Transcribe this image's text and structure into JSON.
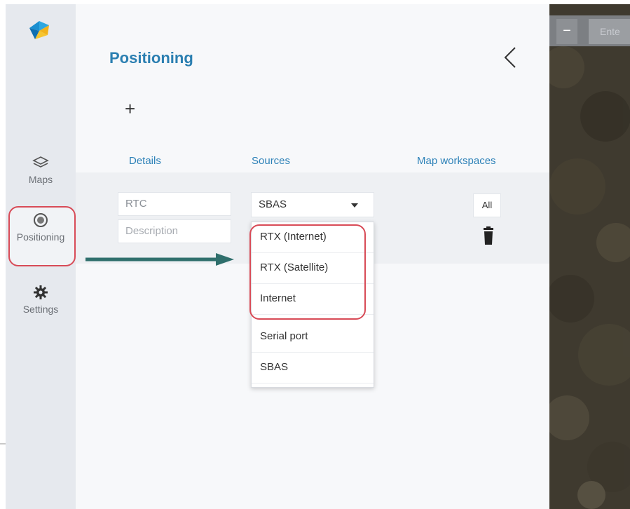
{
  "sidebar": {
    "items": [
      {
        "label": "Maps",
        "icon": "layers-icon"
      },
      {
        "label": "Positioning",
        "icon": "target-icon"
      },
      {
        "label": "Settings",
        "icon": "gear-icon"
      }
    ]
  },
  "panel": {
    "title": "Positioning",
    "add_symbol": "+",
    "columns": {
      "details": "Details",
      "sources": "Sources",
      "map_workspaces": "Map workspaces"
    },
    "row": {
      "name_value": "RTC",
      "description_placeholder": "Description",
      "source_selected": "SBAS",
      "workspaces_button": "All"
    },
    "source_options": [
      "RTX (Internet)",
      "RTX (Satellite)",
      "Internet",
      "Serial port",
      "SBAS"
    ]
  },
  "map": {
    "zoom_out_label": "−",
    "search_placeholder": "Ente"
  },
  "colors": {
    "accent": "#2b7fb1",
    "highlight": "#d84b57",
    "arrow": "#2f6f6c",
    "sidebar_bg": "#e6e9ee"
  }
}
